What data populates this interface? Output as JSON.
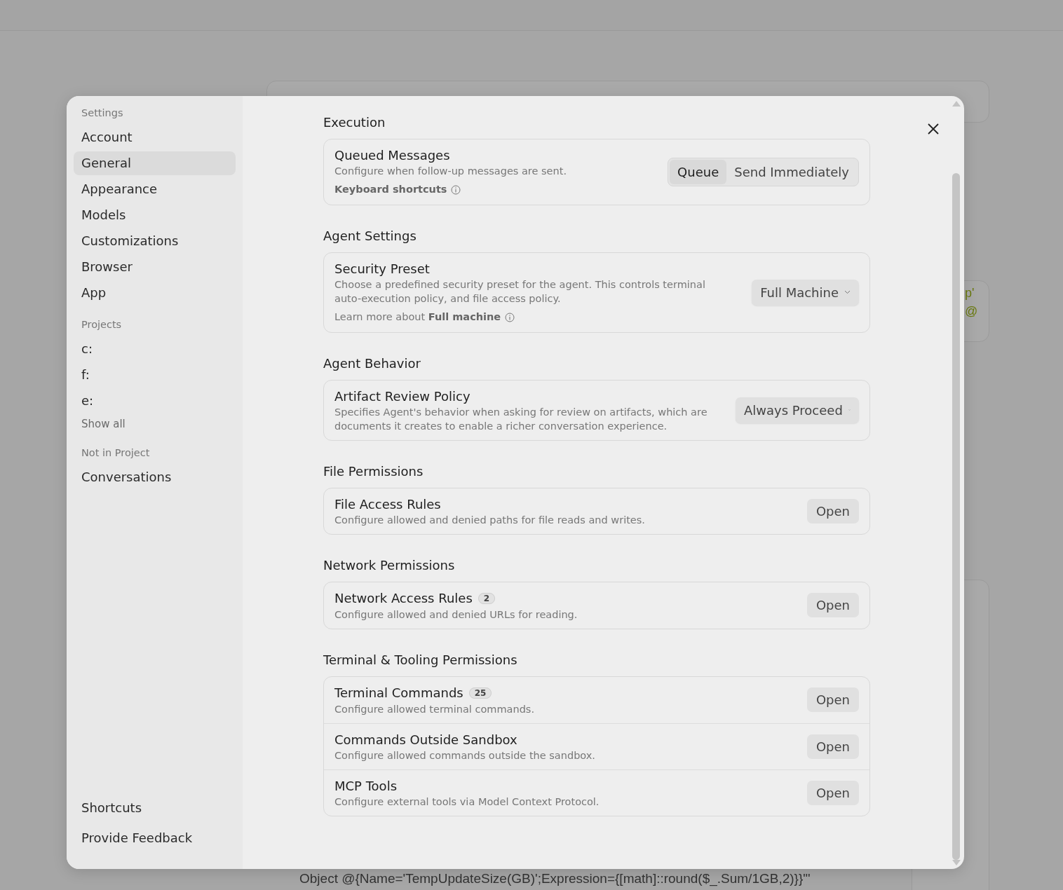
{
  "background": {
    "fragments": [
      "p'",
      "@"
    ],
    "code_line": "Object @{Name='TempUpdateSize(GB)';Expression={[math]::round($_.Sum/1GB,2)}}\"'"
  },
  "sidebar": {
    "sections": [
      {
        "heading": "Settings",
        "items": [
          {
            "label": "Account",
            "selected": false
          },
          {
            "label": "General",
            "selected": true
          },
          {
            "label": "Appearance",
            "selected": false
          },
          {
            "label": "Models",
            "selected": false
          },
          {
            "label": "Customizations",
            "selected": false
          },
          {
            "label": "Browser",
            "selected": false
          },
          {
            "label": "App",
            "selected": false
          }
        ]
      },
      {
        "heading": "Projects",
        "items": [
          {
            "label": "c:",
            "selected": false
          },
          {
            "label": "f:",
            "selected": false
          },
          {
            "label": "e:",
            "selected": false
          }
        ],
        "more": "Show all"
      },
      {
        "heading": "Not in Project",
        "items": [
          {
            "label": "Conversations",
            "selected": false
          }
        ]
      }
    ],
    "footer_items": [
      "Shortcuts",
      "Provide Feedback"
    ]
  },
  "groups": [
    {
      "title": "Execution",
      "rows": [
        {
          "title": "Queued Messages",
          "description": "Configure when follow-up messages are sent.",
          "link": "**Keyboard shortcuts**",
          "control": {
            "kind": "segmented",
            "options": [
              {
                "label": "Queue",
                "selected": true
              },
              {
                "label": "Send Immediately",
                "selected": false
              }
            ]
          }
        }
      ]
    },
    {
      "title": "Agent Settings",
      "rows": [
        {
          "title": "Security Preset",
          "description": "Choose a predefined security preset for the agent. This controls terminal auto-execution policy, and file access policy.",
          "link": "Learn more about **Full machine**",
          "control": {
            "kind": "dropdown",
            "value": "Full Machine"
          }
        }
      ]
    },
    {
      "title": "Agent Behavior",
      "rows": [
        {
          "title": "Artifact Review Policy",
          "description": "Specifies Agent's behavior when asking for review on artifacts, which are documents it creates to enable a richer conversation experience.",
          "control": {
            "kind": "dropdown",
            "value": "Always Proceed"
          }
        }
      ]
    },
    {
      "title": "File Permissions",
      "rows": [
        {
          "title": "File Access Rules",
          "description": "Configure allowed and denied paths for file reads and writes.",
          "control": {
            "kind": "button",
            "label": "Open"
          }
        }
      ]
    },
    {
      "title": "Network Permissions",
      "rows": [
        {
          "title": "Network Access Rules",
          "count": "2",
          "description": "Configure allowed and denied URLs for reading.",
          "control": {
            "kind": "button",
            "label": "Open"
          }
        }
      ]
    },
    {
      "title": "Terminal & Tooling Permissions",
      "rows": [
        {
          "title": "Terminal Commands",
          "count": "25",
          "description": "Configure allowed terminal commands.",
          "control": {
            "kind": "button",
            "label": "Open"
          }
        },
        {
          "title": "Commands Outside Sandbox",
          "description": "Configure allowed commands outside the sandbox.",
          "control": {
            "kind": "button",
            "label": "Open"
          }
        },
        {
          "title": "MCP Tools",
          "description": "Configure external tools via Model Context Protocol.",
          "control": {
            "kind": "button",
            "label": "Open"
          }
        }
      ]
    }
  ]
}
